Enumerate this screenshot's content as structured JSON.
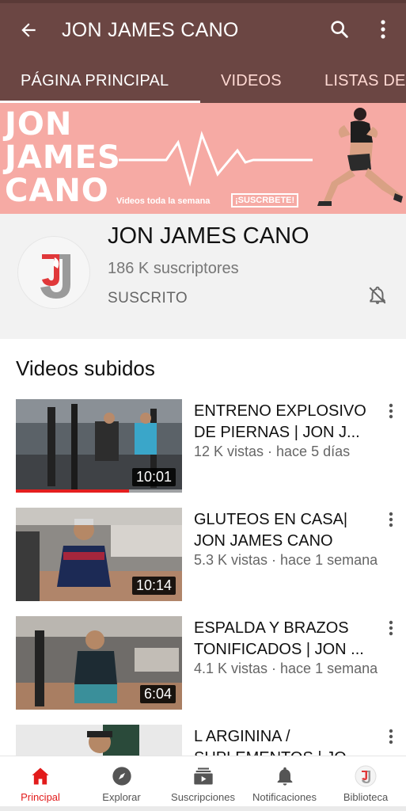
{
  "appbar": {
    "title": "JON JAMES CANO",
    "tabs": [
      {
        "label": "PÁGINA PRINCIPAL"
      },
      {
        "label": "VIDEOS"
      },
      {
        "label": "LISTAS DE"
      }
    ]
  },
  "banner": {
    "name_line1": "JON",
    "name_line2": "JAMES",
    "name_line3": "CANO",
    "tagline": "Videos toda la semana",
    "cta": "¡SUSCRBETE!"
  },
  "channel": {
    "name": "JON JAMES CANO",
    "subscribers": "186 K suscriptores",
    "status": "SUSCRITO"
  },
  "uploads": {
    "section_title": "Videos subidos",
    "videos": [
      {
        "title_line1": "ENTRENO EXPLOSIVO",
        "title_line2": "DE PIERNAS | JON J...",
        "meta": "12 K vistas · hace 5 días",
        "duration": "10:01",
        "watched_fraction": 0.68
      },
      {
        "title_line1": "GLUTEOS EN CASA|",
        "title_line2": "JON JAMES CANO",
        "meta": "5.3 K vistas · hace 1 semana",
        "duration": "10:14"
      },
      {
        "title_line1": "ESPALDA Y BRAZOS",
        "title_line2": "TONIFICADOS | JON ...",
        "meta": "4.1 K vistas · hace 1 semana",
        "duration": "6:04"
      },
      {
        "title_line1": "L ARGININA /",
        "title_line2": "SUPLEMENTOS | JO...",
        "meta": "",
        "duration": ""
      }
    ]
  },
  "bottom_nav": {
    "items": [
      {
        "label": "Principal",
        "icon": "home-icon"
      },
      {
        "label": "Explorar",
        "icon": "compass-icon"
      },
      {
        "label": "Suscripciones",
        "icon": "subscriptions-icon"
      },
      {
        "label": "Notificaciones",
        "icon": "bell-icon"
      },
      {
        "label": "Biblioteca",
        "icon": "library-avatar-icon"
      }
    ]
  },
  "colors": {
    "appbar": "#6b4643",
    "banner": "#f6aaa4",
    "accent_red": "#e21b1b"
  }
}
